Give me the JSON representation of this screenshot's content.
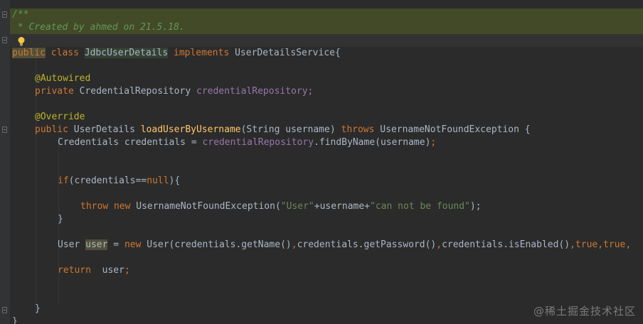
{
  "code": {
    "line1": "/**",
    "line2": " * Created by ahmed on 21.5.18.",
    "line3": " */",
    "class_public": "public",
    "class_kw": "class",
    "class_name": "JdbcUserDetails",
    "class_implements": "implements",
    "class_iface": "UserDetailsService{",
    "autowired": "@Autowired",
    "field_private": "private",
    "field_type": "CredentialRepository",
    "field_name": "credentialRepository;",
    "override": "@Override",
    "m_public": "public",
    "m_type": "UserDetails",
    "m_name": "loadUserByUsername",
    "m_params": "(String username)",
    "m_throws": "throws",
    "m_exc": "UsernameNotFoundException {",
    "l_cred_decl": "Credentials credentials = ",
    "l_cred_field": "credentialRepository",
    "l_cred_call": ".findByName(username)",
    "l_cred_semi": ";",
    "if_kw": "if",
    "if_open": "(credentials==",
    "if_null": "null",
    "if_close": "){",
    "throw_kw": "throw",
    "new_kw": "new",
    "throw_exc": "UsernameNotFoundException(",
    "str_user": "\"User\"",
    "plus_user": "+username+",
    "str_notfound": "\"can not be found\"",
    "throw_end": ");",
    "close_if": "}",
    "user_type": "User ",
    "user_var": "user",
    "user_eq": " = ",
    "user_new": "new",
    "user_ctor": " User(credentials.getName()",
    "comma1": ",",
    "user_pw": "credentials.getPassword()",
    "comma2": ",",
    "user_en": "credentials.isEnabled()",
    "comma3": ",",
    "true1": "true",
    "comma4": ",",
    "true2": "true",
    "comma5": ",",
    "ret_kw": "return",
    "ret_val": "  user",
    "ret_semi": ";",
    "close_method": "}",
    "close_class": "}"
  },
  "icons": {
    "bulb": "intention-bulb-icon",
    "fold": "fold-marker-icon"
  },
  "watermark": "@稀土掘金技术社区",
  "colors": {
    "background": "#2b2b2b",
    "keyword": "#cc7832",
    "annotation": "#bbb529",
    "field": "#9876aa",
    "method": "#ffc66d",
    "string": "#6a8759",
    "comment": "#629755",
    "text": "#a9b7c6"
  }
}
